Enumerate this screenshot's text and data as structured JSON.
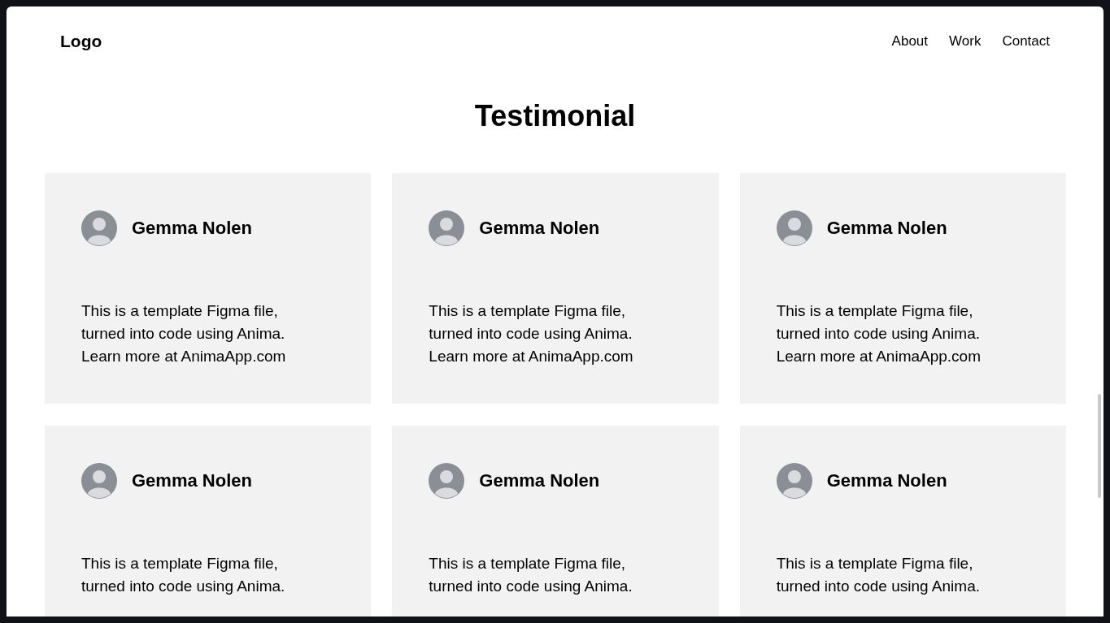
{
  "header": {
    "logo": "Logo",
    "nav": [
      "About",
      "Work",
      "Contact"
    ]
  },
  "title": "Testimonial",
  "testimonials": [
    {
      "name": "Gemma Nolen",
      "lines": [
        "This is a template Figma file,",
        "turned into code using Anima.",
        "Learn more at AnimaApp.com"
      ]
    },
    {
      "name": "Gemma Nolen",
      "lines": [
        "This is a template Figma file,",
        "turned into code using Anima.",
        "Learn more at AnimaApp.com"
      ]
    },
    {
      "name": "Gemma Nolen",
      "lines": [
        "This is a template Figma file,",
        "turned into code using Anima.",
        "Learn more at AnimaApp.com"
      ]
    },
    {
      "name": "Gemma Nolen",
      "lines": [
        "This is a template Figma file,",
        "turned into code using Anima."
      ]
    },
    {
      "name": "Gemma Nolen",
      "lines": [
        "This is a template Figma file,",
        "turned into code using Anima."
      ]
    },
    {
      "name": "Gemma Nolen",
      "lines": [
        "This is a template Figma file,",
        "turned into code using Anima."
      ]
    }
  ]
}
